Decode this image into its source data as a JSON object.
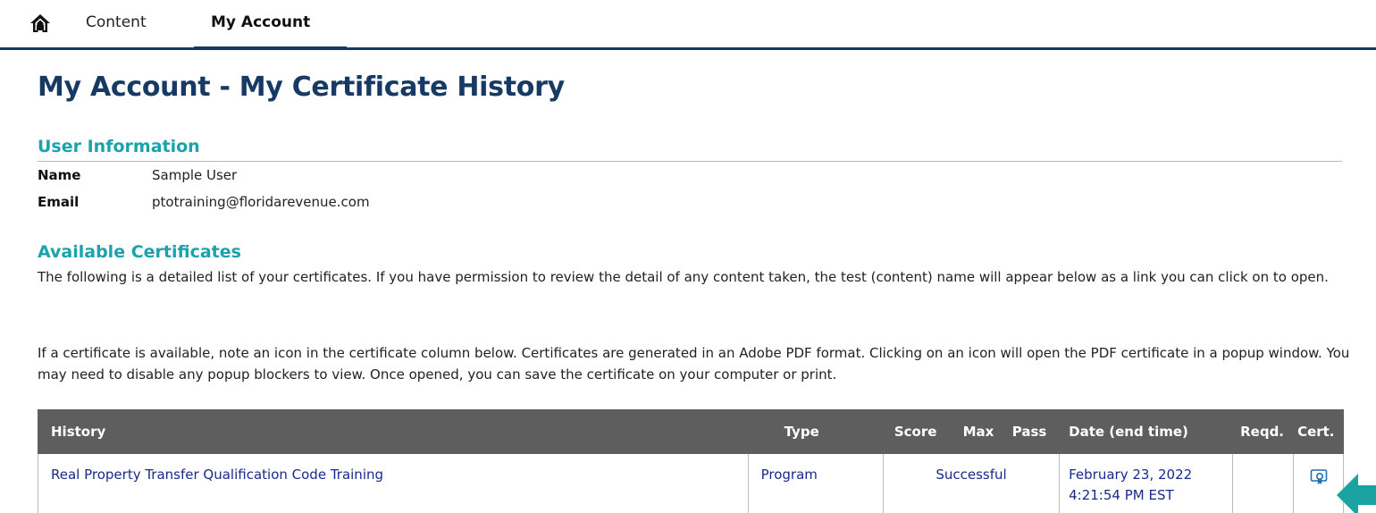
{
  "nav": {
    "home_icon": "home-icon",
    "tabs": [
      {
        "label": "Content"
      },
      {
        "label": "My Account"
      }
    ]
  },
  "page": {
    "title": "My Account - My Certificate History"
  },
  "user_info": {
    "heading": "User Information",
    "name_label": "Name",
    "name_value": "Sample User",
    "email_label": "Email",
    "email_value": "ptotraining@floridarevenue.com"
  },
  "certificates": {
    "heading": "Available Certificates",
    "paragraph1": "The following is a detailed list of your certificates. If you have permission to review the detail of any content taken, the test (content) name will appear below as a link you can click on to open.",
    "paragraph2": "If a certificate is available, note an icon in the certificate column below. Certificates are generated in an Adobe PDF format. Clicking on an icon will open the PDF certificate in a popup window. You may need to disable any popup blockers to view. Once opened, you can save the certificate on your computer or print.",
    "table": {
      "headers": {
        "history": "History",
        "type": "Type",
        "score": "Score",
        "max": "Max",
        "pass": "Pass",
        "date": "Date (end time)",
        "reqd": "Reqd.",
        "cert": "Cert."
      },
      "rows": [
        {
          "history": "Real Property Transfer Qualification Code Training",
          "type": "Program",
          "result": "Successful",
          "date_line1": "February 23, 2022",
          "date_line2": "4:21:54 PM EST",
          "reqd": "",
          "cert_icon": "certificate-icon"
        }
      ]
    }
  },
  "colors": {
    "title": "#173a64",
    "section_heading": "#1aa3ad",
    "table_header_bg": "#5e5e5e",
    "link": "#1a2a8a",
    "arrow": "#1aa3a0"
  }
}
